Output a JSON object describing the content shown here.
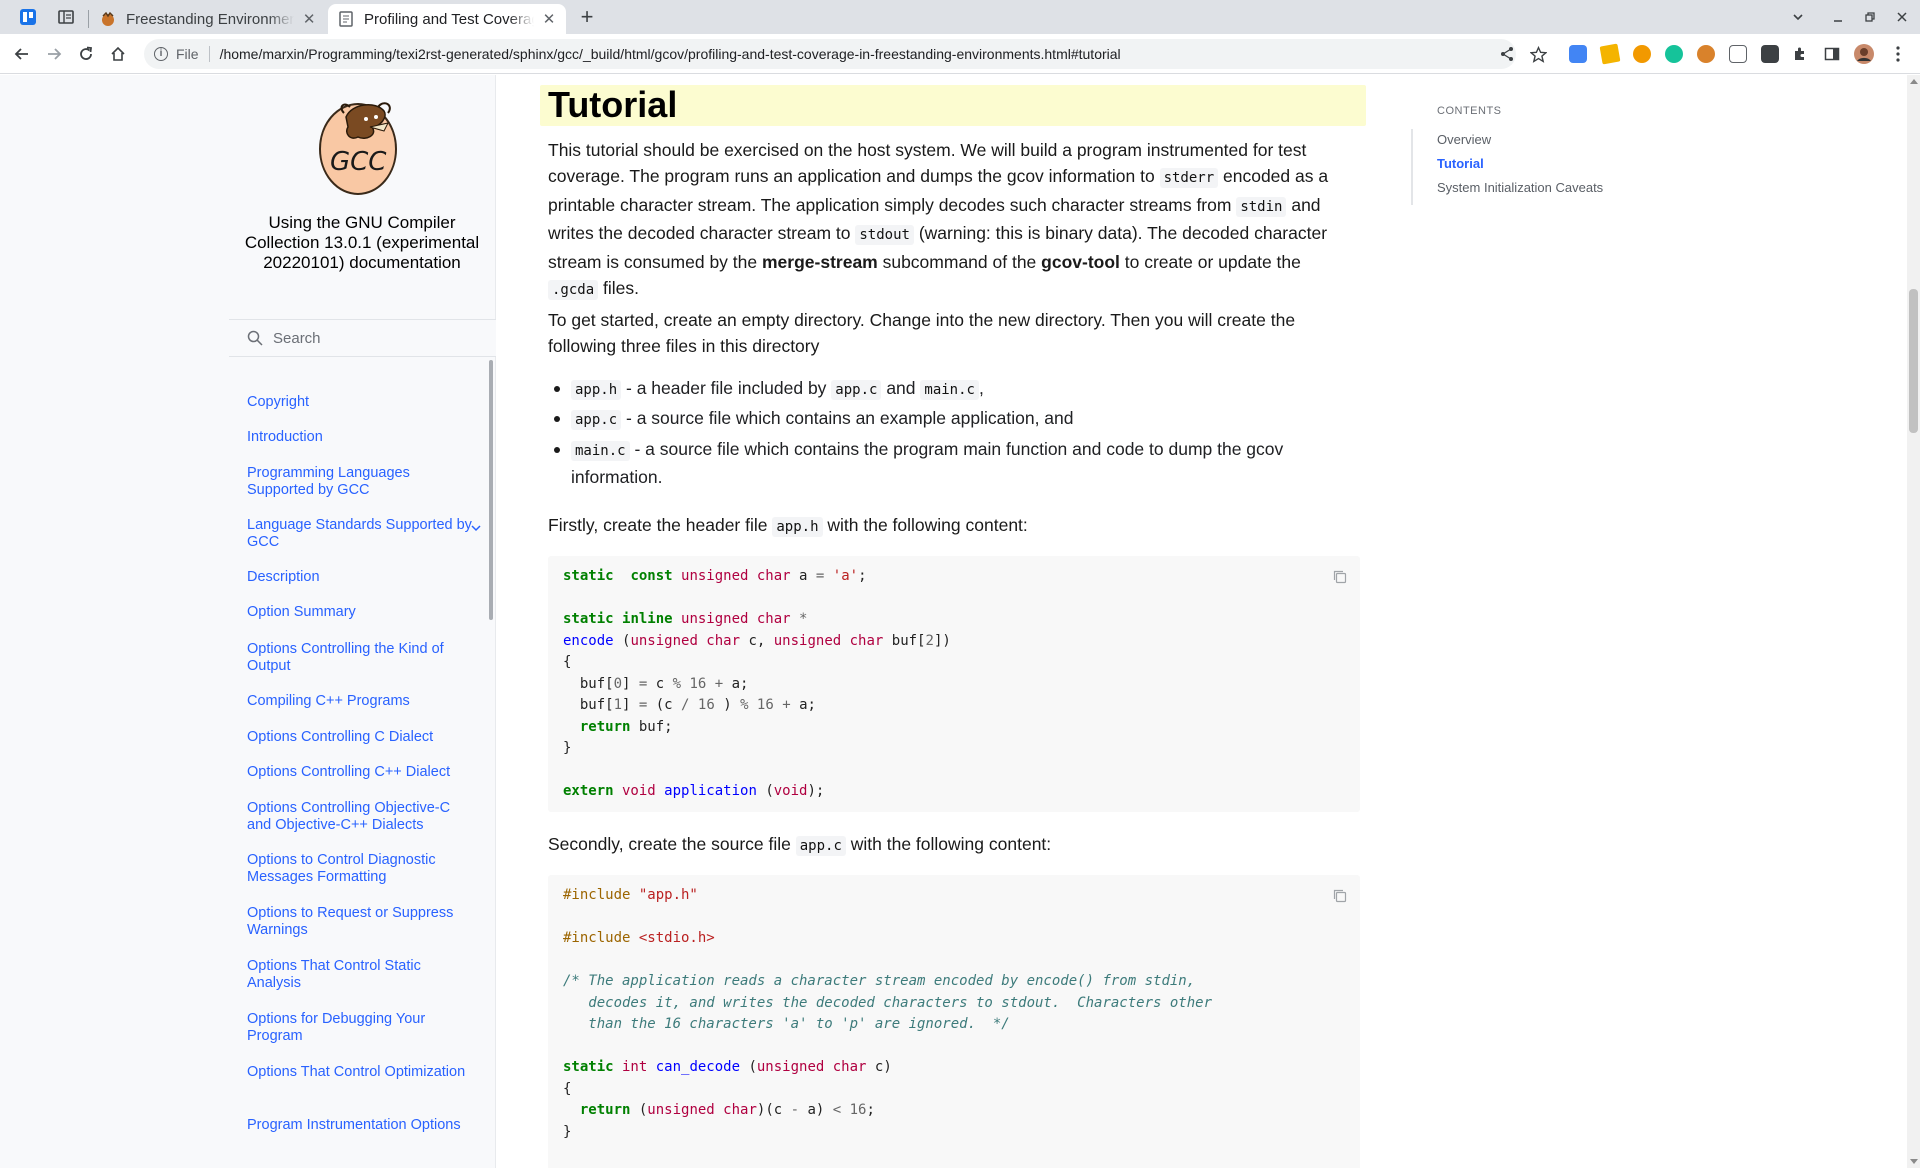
{
  "browser": {
    "tabs": [
      {
        "title": "Freestanding Environmen",
        "active": false
      },
      {
        "title": "Profiling and Test Coverag",
        "active": true
      }
    ],
    "new_tab_symbol": "+",
    "close_symbol": "✕",
    "url_scheme_label": "File",
    "url": "/home/marxin/Programming/texi2rst-generated/sphinx/gcc/_build/html/gcov/profiling-and-test-coverage-in-freestanding-environments.html#tutorial",
    "logo_text": "GCC"
  },
  "sidebar": {
    "doc_title": "Using the GNU Compiler Collection 13.0.1 (experimental 20220101) documentation",
    "search_placeholder": "Search",
    "items": [
      {
        "label": "Copyright"
      },
      {
        "label": "Introduction"
      },
      {
        "label": "Programming Languages Supported by GCC"
      },
      {
        "label": "Language Standards Supported by GCC"
      },
      {
        "label": "Description"
      },
      {
        "label": "Option Summary"
      },
      {
        "label": "Options Controlling the Kind of Output"
      },
      {
        "label": "Compiling C++ Programs"
      },
      {
        "label": "Options Controlling C Dialect"
      },
      {
        "label": "Options Controlling C++ Dialect"
      },
      {
        "label": "Options Controlling Objective-C and Objective-C++ Dialects"
      },
      {
        "label": "Options to Control Diagnostic Messages Formatting"
      },
      {
        "label": "Options to Request or Suppress Warnings"
      },
      {
        "label": "Options That Control Static Analysis"
      },
      {
        "label": "Options for Debugging Your Program"
      },
      {
        "label": "Options That Control Optimization"
      },
      {
        "label": "Program Instrumentation Options"
      }
    ]
  },
  "main": {
    "heading": "Tutorial",
    "intro": {
      "t1": "This tutorial should be exercised on the host system. We will build a program instrumented for test coverage. The program runs an application and dumps the gcov information to ",
      "c1": "stderr",
      "t2": " encoded as a printable character stream. The application simply decodes such character streams from ",
      "c2": "stdin",
      "t3": " and writes the decoded character stream to ",
      "c3": "stdout",
      "t4": " (warning: this is binary data). The decoded character stream is consumed by the ",
      "b1": "merge-stream",
      "t5": " subcommand of the ",
      "b2": "gcov-tool",
      "t6": " to create or update the ",
      "c4": ".gcda",
      "t7": " files."
    },
    "start_para": "To get started, create an empty directory. Change into the new directory. Then you will create the following three files in this directory",
    "bullets": {
      "b1_code": "app.h",
      "b1_t1": " - a header file included by ",
      "b1_code2": "app.c",
      "b1_t2": " and ",
      "b1_code3": "main.c",
      "b1_t3": ",",
      "b2_code": "app.c",
      "b2_t1": " - a source file which contains an example application, and",
      "b3_code": "main.c",
      "b3_t1": " - a source file which contains the program main function and code to dump the gcov information."
    },
    "first_para": {
      "t1": "Firstly, create the header file ",
      "code": "app.h",
      "t2": " with the following content:"
    },
    "second_para": {
      "t1": "Secondly, create the source file ",
      "code": "app.c",
      "t2": " with the following content:"
    },
    "code1": [
      [
        [
          "kw",
          "static"
        ],
        [
          "",
          "  "
        ],
        [
          "kw",
          "const"
        ],
        [
          "",
          ""
        ],
        [
          "ty",
          " unsigned"
        ],
        [
          "ty",
          " char"
        ],
        [
          "",
          " a "
        ],
        [
          "op",
          "="
        ],
        [
          "st",
          " 'a'"
        ],
        [
          "",
          ";"
        ]
      ],
      [],
      [
        [
          "kw",
          "static"
        ],
        [
          "",
          " "
        ],
        [
          "kw",
          "inline"
        ],
        [
          "ty",
          " unsigned"
        ],
        [
          "ty",
          " char"
        ],
        [
          "op",
          " *"
        ]
      ],
      [
        [
          "fn",
          "encode"
        ],
        [
          "",
          " ("
        ],
        [
          "ty",
          "unsigned"
        ],
        [
          "ty",
          " char"
        ],
        [
          "",
          " c, "
        ],
        [
          "ty",
          "unsigned"
        ],
        [
          "ty",
          " char"
        ],
        [
          "",
          " buf["
        ],
        [
          "nm",
          "2"
        ],
        [
          "",
          "])"
        ]
      ],
      [
        [
          "",
          "{"
        ]
      ],
      [
        [
          "",
          "  buf["
        ],
        [
          "nm",
          "0"
        ],
        [
          "",
          "] "
        ],
        [
          "op",
          "="
        ],
        [
          "",
          " c "
        ],
        [
          "op",
          "%"
        ],
        [
          "nm",
          " 16"
        ],
        [
          "op",
          " +"
        ],
        [
          "",
          " a;"
        ]
      ],
      [
        [
          "",
          "  buf["
        ],
        [
          "nm",
          "1"
        ],
        [
          "",
          "] "
        ],
        [
          "op",
          "="
        ],
        [
          "",
          " (c "
        ],
        [
          "op",
          "/"
        ],
        [
          "nm",
          " 16"
        ],
        [
          "",
          " ) "
        ],
        [
          "op",
          "%"
        ],
        [
          "nm",
          " 16"
        ],
        [
          "op",
          " +"
        ],
        [
          "",
          " a;"
        ]
      ],
      [
        [
          "kw",
          "  return"
        ],
        [
          "",
          " buf;"
        ]
      ],
      [
        [
          "",
          "}"
        ]
      ],
      [],
      [
        [
          "kw",
          "extern"
        ],
        [
          "ty",
          " void"
        ],
        [
          "fn",
          " application"
        ],
        [
          "",
          " ("
        ],
        [
          "ty",
          "void"
        ],
        [
          "",
          ");"
        ]
      ]
    ],
    "code2": [
      [
        [
          "pp",
          "#include "
        ],
        [
          "st",
          "\"app.h\""
        ]
      ],
      [],
      [
        [
          "pp",
          "#include "
        ],
        [
          "st",
          "<stdio.h>"
        ]
      ],
      [],
      [
        [
          "cm",
          "/* The application reads a character stream encoded by encode() from stdin,"
        ]
      ],
      [
        [
          "cm",
          "   decodes it, and writes the decoded characters to stdout.  Characters other"
        ]
      ],
      [
        [
          "cm",
          "   than the 16 characters 'a' to 'p' are ignored.  */"
        ]
      ],
      [],
      [
        [
          "kw",
          "static"
        ],
        [
          "ty",
          " int"
        ],
        [
          "fn",
          " can_decode"
        ],
        [
          "",
          " ("
        ],
        [
          "ty",
          "unsigned"
        ],
        [
          "ty",
          " char"
        ],
        [
          "",
          " c)"
        ]
      ],
      [
        [
          "",
          "{"
        ]
      ],
      [
        [
          "kw",
          "  return"
        ],
        [
          "",
          " ("
        ],
        [
          "ty",
          "unsigned"
        ],
        [
          "ty",
          " char"
        ],
        [
          "",
          ")(c "
        ],
        [
          "op",
          "-"
        ],
        [
          "",
          " a) "
        ],
        [
          "op",
          "<"
        ],
        [
          "nm",
          " 16"
        ],
        [
          "",
          ";"
        ]
      ],
      [
        [
          "",
          "}"
        ]
      ]
    ]
  },
  "toc": {
    "heading": "CONTENTS",
    "items": [
      {
        "label": "Overview",
        "active": false
      },
      {
        "label": "Tutorial",
        "active": true
      },
      {
        "label": "System Initialization Caveats",
        "active": false
      }
    ]
  },
  "colors": {
    "link": "#2962ff",
    "heading_highlight": "#fcfcd0",
    "code_bg": "#f8f8f8"
  }
}
